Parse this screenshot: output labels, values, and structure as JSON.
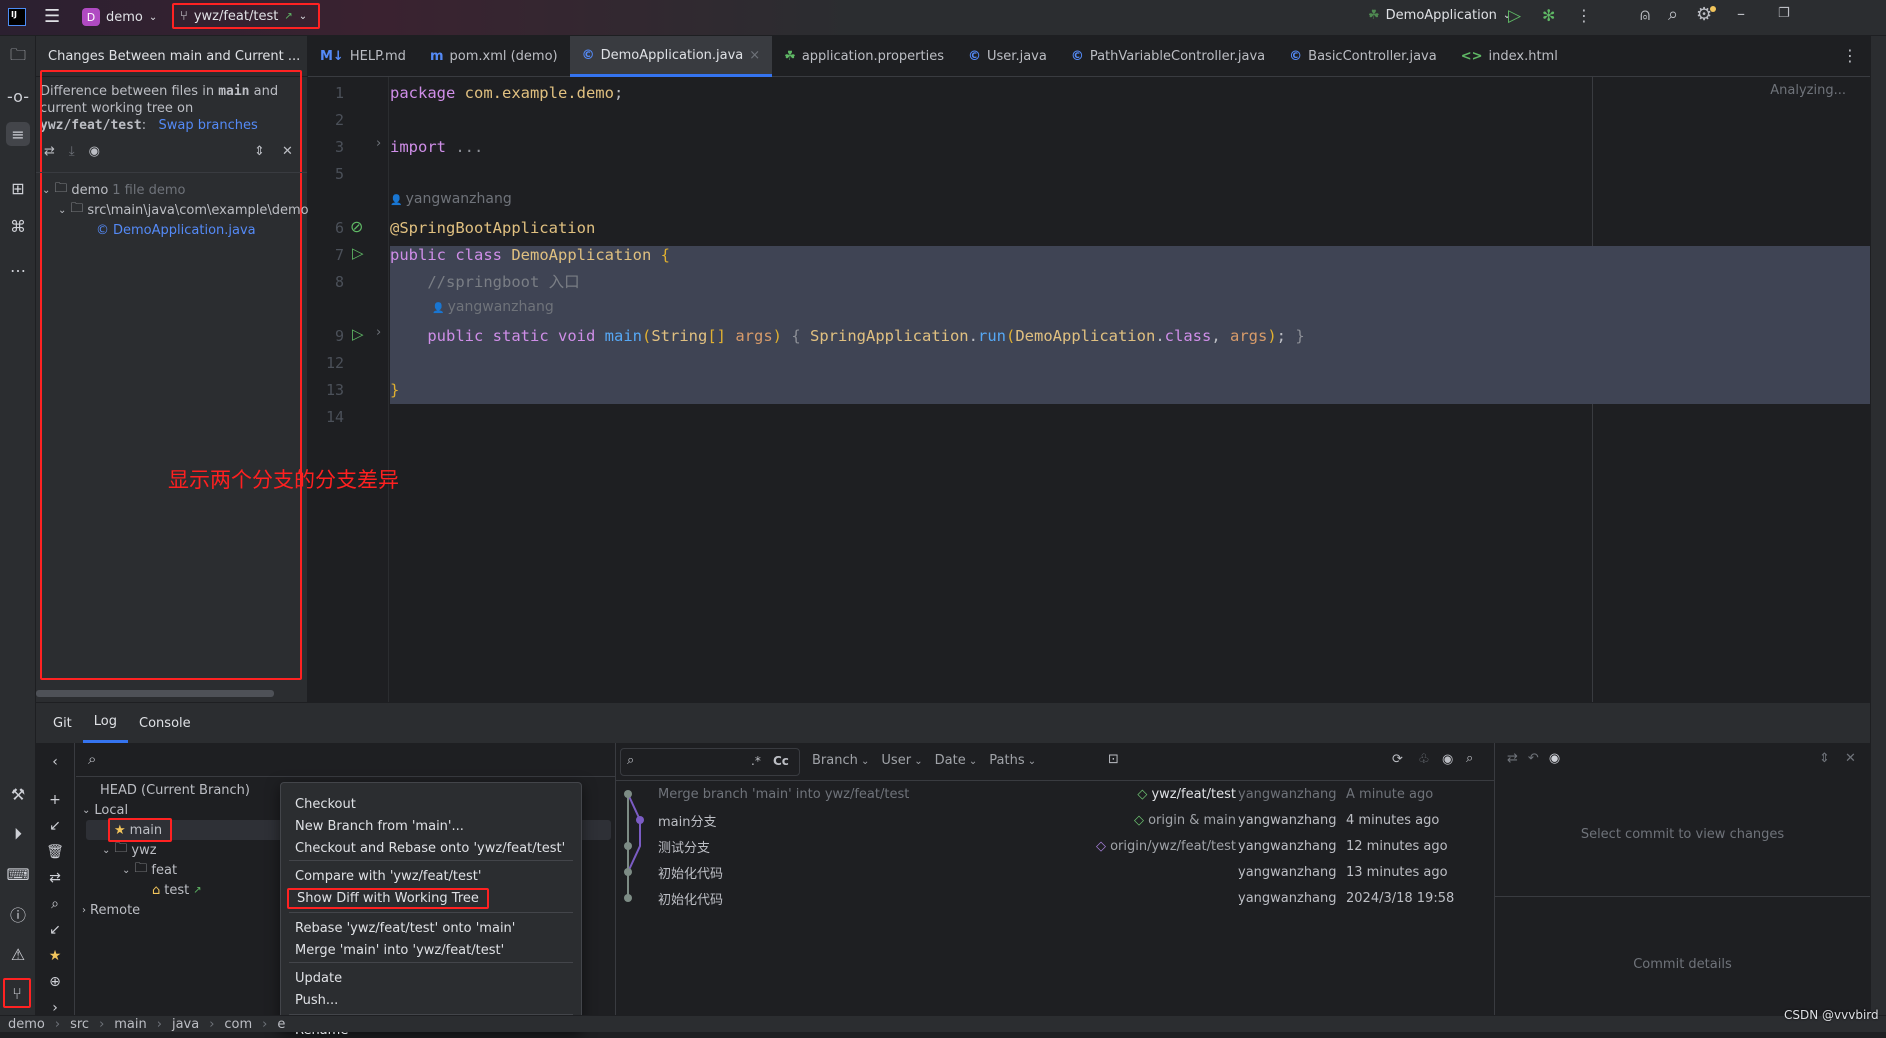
{
  "titlebar": {
    "logo": "IJ",
    "project_badge": "D",
    "project": "demo",
    "branch": "ywz/feat/test",
    "run_config": "DemoApplication"
  },
  "left_panel": {
    "title": "Changes Between main and Current ...",
    "desc_prefix": "Difference between files in ",
    "desc_branch": "main",
    "desc_mid": " and current working tree on ",
    "desc_target": "ywz/feat/test",
    "desc_colon": ":",
    "swap_link": "Swap branches",
    "tree": {
      "root": "demo",
      "root_meta": "1 file  demo",
      "folder": "src\\main\\java\\com\\example\\demo",
      "file": "DemoApplication.java"
    }
  },
  "annotation": "显示两个分支的分支差异",
  "editor_tabs": [
    {
      "label": "HELP.md",
      "icon": "markdown-icon",
      "glyph": "M↓",
      "color": "#548af7"
    },
    {
      "label": "pom.xml (demo)",
      "icon": "maven-icon",
      "glyph": "m",
      "color": "#548af7"
    },
    {
      "label": "DemoApplication.java",
      "icon": "java-class-icon",
      "glyph": "©",
      "color": "#548af7",
      "active": true
    },
    {
      "label": "application.properties",
      "icon": "spring-icon",
      "glyph": "☘",
      "color": "#5fb865"
    },
    {
      "label": "User.java",
      "icon": "java-class-icon",
      "glyph": "©",
      "color": "#548af7"
    },
    {
      "label": "PathVariableController.java",
      "icon": "java-class-icon",
      "glyph": "©",
      "color": "#548af7"
    },
    {
      "label": "BasicController.java",
      "icon": "java-class-icon",
      "glyph": "©",
      "color": "#548af7"
    },
    {
      "label": "index.html",
      "icon": "html-icon",
      "glyph": "<>",
      "color": "#5fb865"
    }
  ],
  "editor": {
    "status": "Analyzing...",
    "author": "yangwanzhang",
    "lines": [
      {
        "num": "1",
        "tokens": [
          [
            "package ",
            "#cf8ee8"
          ],
          [
            "com.example.demo",
            "#e0c080"
          ],
          [
            ";",
            "#bcbec4"
          ]
        ]
      },
      {
        "num": "2",
        "tokens": []
      },
      {
        "num": "3",
        "tokens": [
          [
            "import ",
            "#cf8ee8"
          ],
          [
            "...",
            "#8c8f96"
          ]
        ]
      },
      {
        "num": "5",
        "tokens": []
      },
      {
        "num": "6",
        "tokens": [
          [
            "@SpringBootApplication",
            "#e0c080"
          ]
        ]
      },
      {
        "num": "7",
        "tokens": [
          [
            "public ",
            "#cf8ee8"
          ],
          [
            "class ",
            "#cf8ee8"
          ],
          [
            "DemoApplication ",
            "#e0c080"
          ],
          [
            "{",
            "#e0b030"
          ]
        ]
      },
      {
        "num": "8",
        "tokens": [
          [
            "    //springboot 入口",
            "#7a7e85"
          ]
        ]
      },
      {
        "num": "9",
        "tokens": [
          [
            "    public ",
            "#cf8ee8"
          ],
          [
            "static ",
            "#cf8ee8"
          ],
          [
            "void ",
            "#cf8ee8"
          ],
          [
            "main",
            "#56a8f5"
          ],
          [
            "(",
            "#e0b030"
          ],
          [
            "String",
            "#e0c080"
          ],
          [
            "[] ",
            "#e0b030"
          ],
          [
            "args",
            "#d79b6a"
          ],
          [
            ") ",
            "#e0b030"
          ],
          [
            "{ ",
            "#8c8f96"
          ],
          [
            "SpringApplication",
            "#e0c080"
          ],
          [
            ".",
            "#bcbec4"
          ],
          [
            "run",
            "#56a8f5"
          ],
          [
            "(",
            "#e0b030"
          ],
          [
            "DemoApplication",
            "#e0c080"
          ],
          [
            ".",
            "#bcbec4"
          ],
          [
            "class",
            "#cf8ee8"
          ],
          [
            ", ",
            "#bcbec4"
          ],
          [
            "args",
            "#d79b6a"
          ],
          [
            ")",
            "#e0b030"
          ],
          [
            "; ",
            "#bcbec4"
          ],
          [
            "}",
            "#8c8f96"
          ]
        ]
      },
      {
        "num": "12",
        "tokens": []
      },
      {
        "num": "13",
        "tokens": [
          [
            "}",
            "#e0b030"
          ]
        ]
      },
      {
        "num": "14",
        "tokens": []
      }
    ]
  },
  "bottom_tabs": [
    "Git",
    "Log",
    "Console"
  ],
  "branches": {
    "head": "HEAD (Current Branch)",
    "local": "Local",
    "main": "main",
    "ywz": "ywz",
    "feat": "feat",
    "test": "test",
    "remote": "Remote"
  },
  "context_menu": {
    "items": [
      "Checkout",
      "New Branch from 'main'...",
      "Checkout and Rebase onto 'ywz/feat/test'",
      "Compare with 'ywz/feat/test'",
      "Show Diff with Working Tree",
      "Rebase 'ywz/feat/test' onto 'main'",
      "Merge 'main' into 'ywz/feat/test'",
      "Update",
      "Push...",
      "Rename"
    ]
  },
  "log": {
    "filters": [
      "Branch",
      "User",
      "Date",
      "Paths"
    ],
    "regex": ".*",
    "case": "Cc",
    "commits": [
      {
        "msg": "Merge branch 'main' into ywz/feat/test",
        "ref": "ywz/feat/test",
        "author": "yangwanzhang",
        "date": "A minute ago",
        "dim": true
      },
      {
        "msg": "main分支",
        "ref": "origin & main",
        "author": "yangwanzhang",
        "date": "4 minutes ago"
      },
      {
        "msg": "测试分支",
        "ref": "origin/ywz/feat/test",
        "author": "yangwanzhang",
        "date": "12 minutes ago"
      },
      {
        "msg": "初始化代码",
        "ref": "",
        "author": "yangwanzhang",
        "date": "13 minutes ago"
      },
      {
        "msg": "初始化代码",
        "ref": "",
        "author": "yangwanzhang",
        "date": "2024/3/18 19:58"
      }
    ]
  },
  "details": {
    "empty_changes": "Select commit to view changes",
    "empty_details": "Commit details"
  },
  "statusbar": {
    "crumbs": [
      "demo",
      "src",
      "main",
      "java",
      "com",
      "e"
    ],
    "watermark": "CSDN @vvvbird"
  },
  "colors": {
    "accent": "#3574f0",
    "annotation": "#ff2020",
    "selection": "#3f4454"
  }
}
